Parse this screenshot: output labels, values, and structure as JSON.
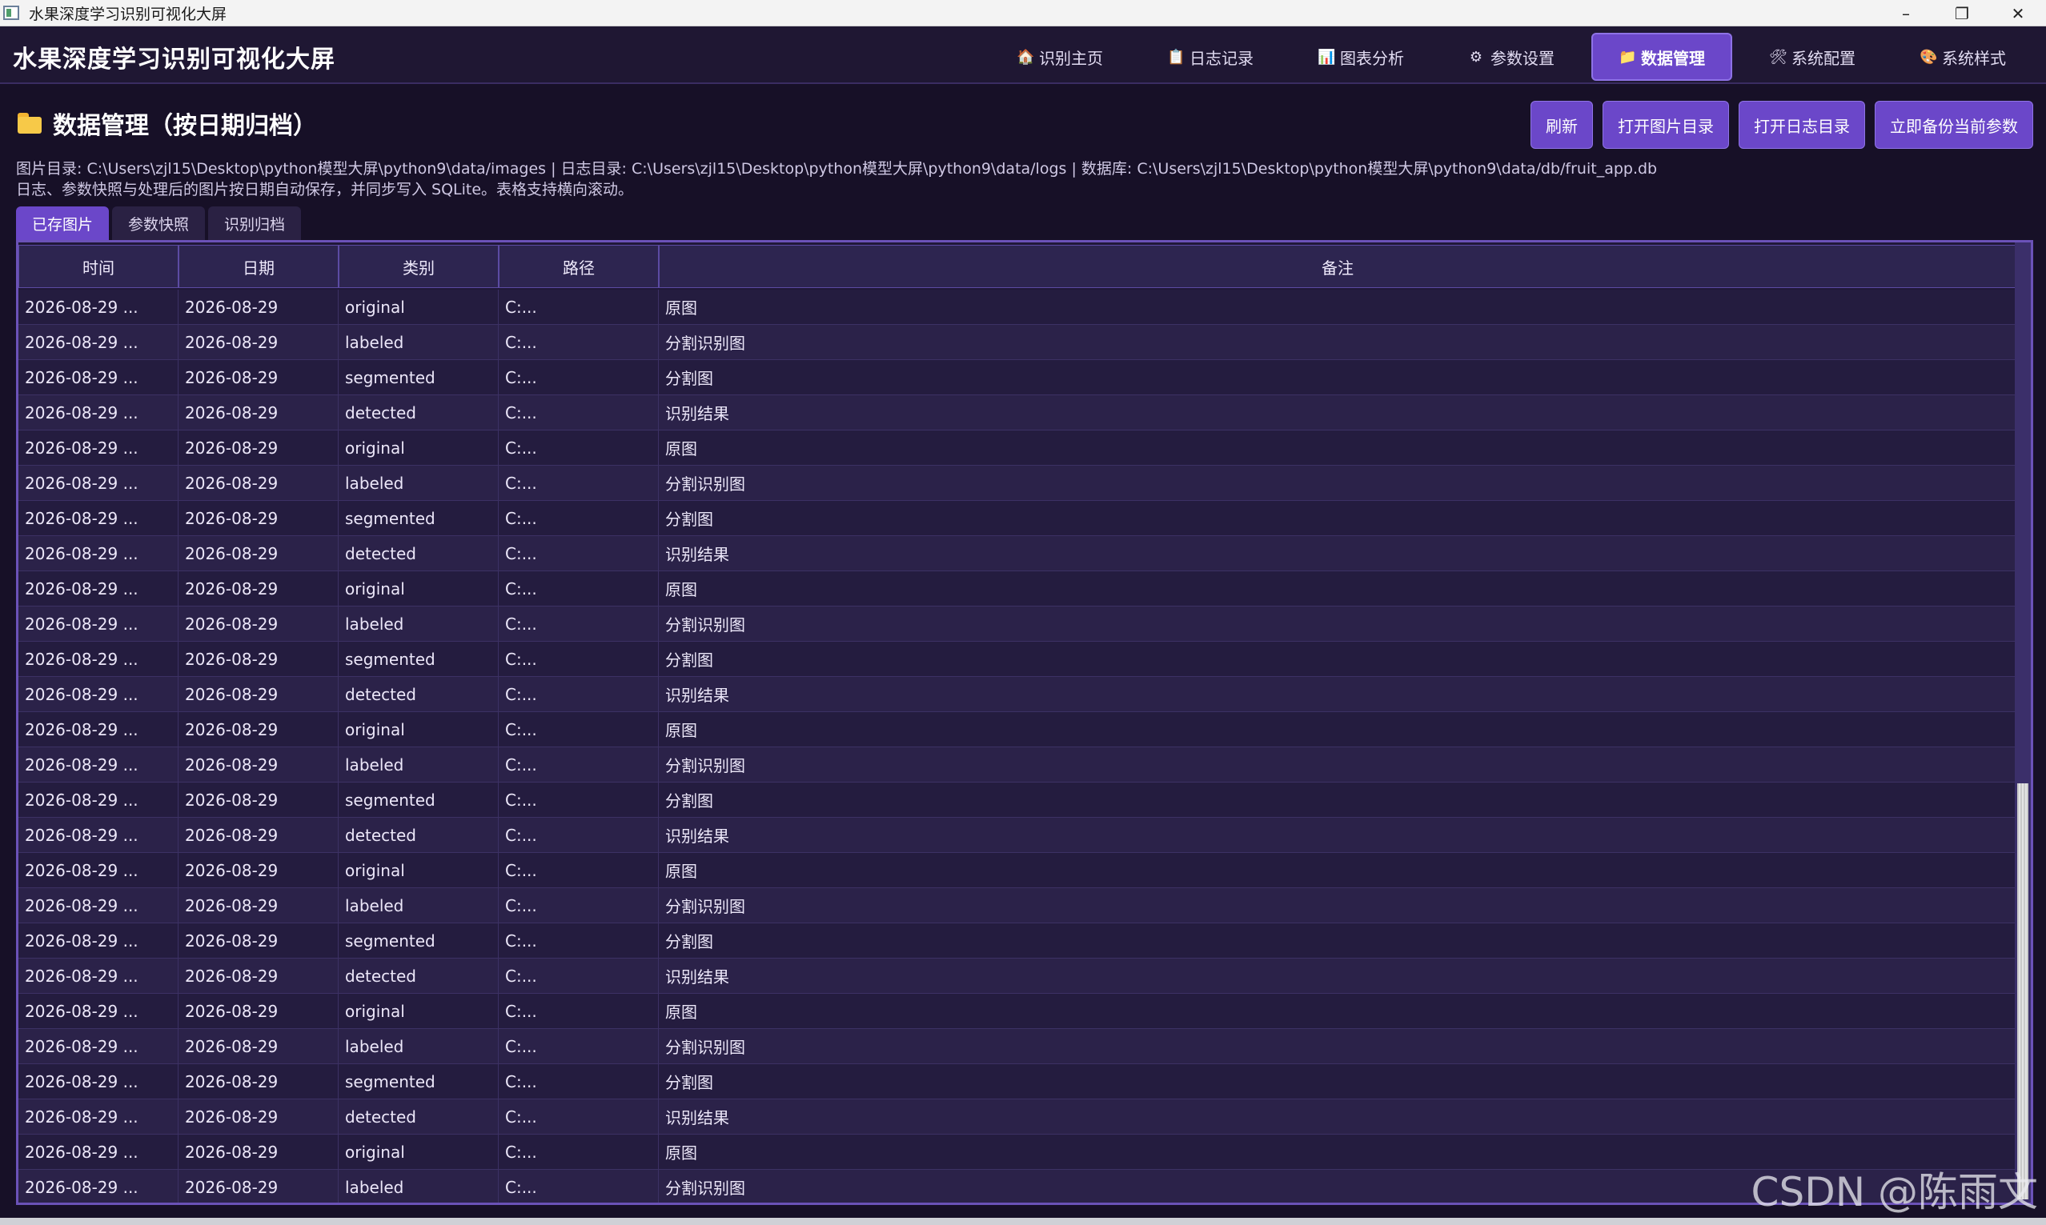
{
  "window": {
    "title": "水果深度学习识别可视化大屏",
    "controls": [
      "–",
      "❐",
      "✕"
    ]
  },
  "header": {
    "title": "水果深度学习识别可视化大屏",
    "nav": [
      {
        "label": "识别主页",
        "icon": "house-icon",
        "glyph": "🏠",
        "active": false
      },
      {
        "label": "日志记录",
        "icon": "notepad-icon",
        "glyph": "📋",
        "active": false
      },
      {
        "label": "图表分析",
        "icon": "bar-chart-icon",
        "glyph": "📊",
        "active": false
      },
      {
        "label": "参数设置",
        "icon": "gear-icon",
        "glyph": "⚙",
        "active": false
      },
      {
        "label": "数据管理",
        "icon": "folder-icon",
        "glyph": "📁",
        "active": true
      },
      {
        "label": "系统配置",
        "icon": "tools-icon",
        "glyph": "🛠",
        "active": false
      },
      {
        "label": "系统样式",
        "icon": "palette-icon",
        "glyph": "🎨",
        "active": false
      }
    ]
  },
  "section": {
    "title": "数据管理（按日期归档）",
    "buttons": {
      "refresh": "刷新",
      "open_images": "打开图片目录",
      "open_logs": "打开日志目录",
      "backup": "立即备份当前参数"
    },
    "info_line1": "图片目录: C:\\Users\\zjl15\\Desktop\\python模型大屏\\python9\\data/images  |  日志目录: C:\\Users\\zjl15\\Desktop\\python模型大屏\\python9\\data/logs  |  数据库: C:\\Users\\zjl15\\Desktop\\python模型大屏\\python9\\data/db/fruit_app.db",
    "info_line2": "日志、参数快照与处理后的图片按日期自动保存，并同步写入 SQLite。表格支持横向滚动。"
  },
  "subtabs": [
    {
      "label": "已存图片",
      "active": true
    },
    {
      "label": "参数快照",
      "active": false
    },
    {
      "label": "识别归档",
      "active": false
    }
  ],
  "table": {
    "columns": [
      "时间",
      "日期",
      "类别",
      "路径",
      "备注"
    ],
    "rows": [
      [
        "2026-08-29 ...",
        "2026-08-29",
        "original",
        "C:...",
        "原图"
      ],
      [
        "2026-08-29 ...",
        "2026-08-29",
        "labeled",
        "C:...",
        "分割识别图"
      ],
      [
        "2026-08-29 ...",
        "2026-08-29",
        "segmented",
        "C:...",
        "分割图"
      ],
      [
        "2026-08-29 ...",
        "2026-08-29",
        "detected",
        "C:...",
        "识别结果"
      ],
      [
        "2026-08-29 ...",
        "2026-08-29",
        "original",
        "C:...",
        "原图"
      ],
      [
        "2026-08-29 ...",
        "2026-08-29",
        "labeled",
        "C:...",
        "分割识别图"
      ],
      [
        "2026-08-29 ...",
        "2026-08-29",
        "segmented",
        "C:...",
        "分割图"
      ],
      [
        "2026-08-29 ...",
        "2026-08-29",
        "detected",
        "C:...",
        "识别结果"
      ],
      [
        "2026-08-29 ...",
        "2026-08-29",
        "original",
        "C:...",
        "原图"
      ],
      [
        "2026-08-29 ...",
        "2026-08-29",
        "labeled",
        "C:...",
        "分割识别图"
      ],
      [
        "2026-08-29 ...",
        "2026-08-29",
        "segmented",
        "C:...",
        "分割图"
      ],
      [
        "2026-08-29 ...",
        "2026-08-29",
        "detected",
        "C:...",
        "识别结果"
      ],
      [
        "2026-08-29 ...",
        "2026-08-29",
        "original",
        "C:...",
        "原图"
      ],
      [
        "2026-08-29 ...",
        "2026-08-29",
        "labeled",
        "C:...",
        "分割识别图"
      ],
      [
        "2026-08-29 ...",
        "2026-08-29",
        "segmented",
        "C:...",
        "分割图"
      ],
      [
        "2026-08-29 ...",
        "2026-08-29",
        "detected",
        "C:...",
        "识别结果"
      ],
      [
        "2026-08-29 ...",
        "2026-08-29",
        "original",
        "C:...",
        "原图"
      ],
      [
        "2026-08-29 ...",
        "2026-08-29",
        "labeled",
        "C:...",
        "分割识别图"
      ],
      [
        "2026-08-29 ...",
        "2026-08-29",
        "segmented",
        "C:...",
        "分割图"
      ],
      [
        "2026-08-29 ...",
        "2026-08-29",
        "detected",
        "C:...",
        "识别结果"
      ],
      [
        "2026-08-29 ...",
        "2026-08-29",
        "original",
        "C:...",
        "原图"
      ],
      [
        "2026-08-29 ...",
        "2026-08-29",
        "labeled",
        "C:...",
        "分割识别图"
      ],
      [
        "2026-08-29 ...",
        "2026-08-29",
        "segmented",
        "C:...",
        "分割图"
      ],
      [
        "2026-08-29 ...",
        "2026-08-29",
        "detected",
        "C:...",
        "识别结果"
      ],
      [
        "2026-08-29 ...",
        "2026-08-29",
        "original",
        "C:...",
        "原图"
      ],
      [
        "2026-08-29 ...",
        "2026-08-29",
        "labeled",
        "C:...",
        "分割识别图"
      ]
    ]
  },
  "watermark": "CSDN @陈雨文",
  "colors": {
    "accent": "#6b47c9",
    "background": "#171027",
    "header": "#1f1733",
    "table_border": "#6b52b8"
  }
}
